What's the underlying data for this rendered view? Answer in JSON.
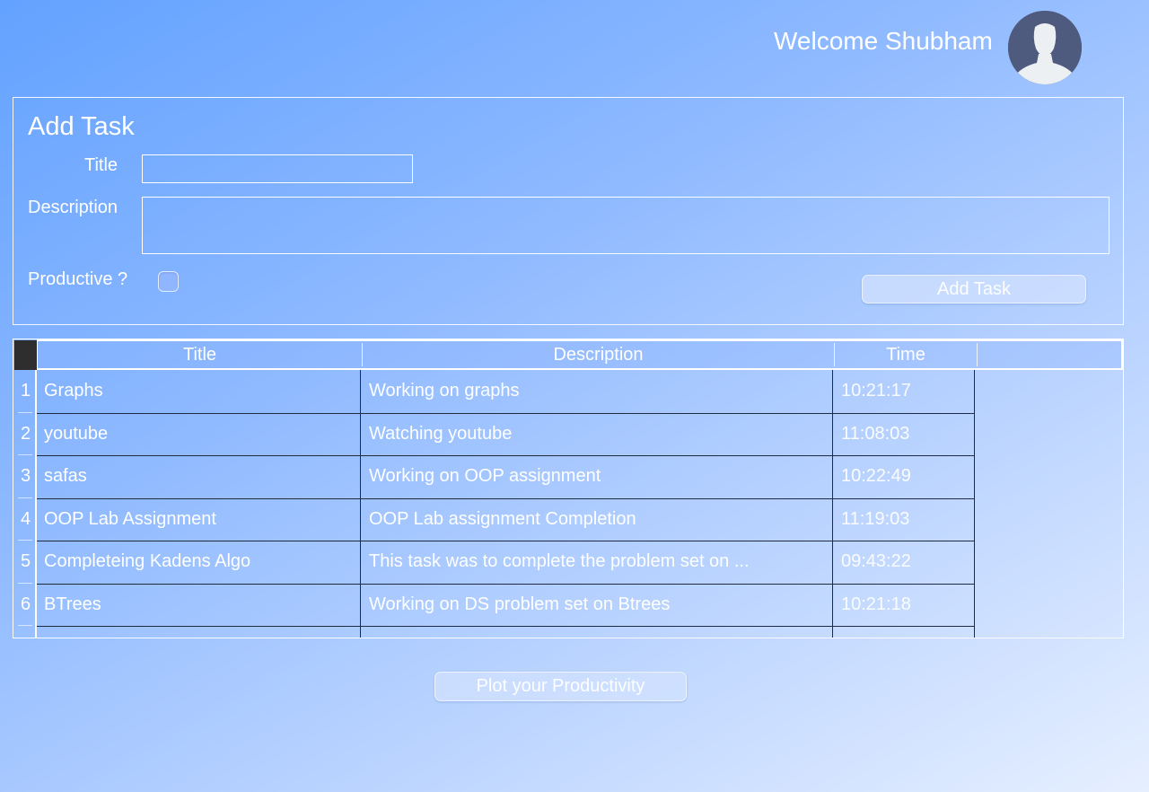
{
  "header": {
    "welcome_text": "Welcome Shubham",
    "avatar_icon": "user-silhouette-icon"
  },
  "add_task": {
    "heading": "Add Task",
    "title_label": "Title",
    "title_value": "",
    "description_label": "Description",
    "description_value": "",
    "productive_label": "Productive ?",
    "productive_checked": false,
    "submit_label": "Add Task"
  },
  "tasks_table": {
    "columns": [
      "Title",
      "Description",
      "Time"
    ],
    "rows": [
      {
        "num": "1",
        "title": "Graphs",
        "description": "Working on graphs",
        "time": "10:21:17"
      },
      {
        "num": "2",
        "title": "youtube",
        "description": "Watching youtube",
        "time": "11:08:03"
      },
      {
        "num": "3",
        "title": "safas",
        "description": "Working on OOP assignment",
        "time": "10:22:49"
      },
      {
        "num": "4",
        "title": "OOP Lab Assignment",
        "description": "OOP Lab assignment Completion",
        "time": "11:19:03"
      },
      {
        "num": "5",
        "title": "Completeing Kadens Algo",
        "description": "This task was to complete the problem set on ...",
        "time": "09:43:22"
      },
      {
        "num": "6",
        "title": "BTrees",
        "description": "Working on DS problem set on Btrees",
        "time": "10:21:18"
      }
    ]
  },
  "plot_button_label": "Plot your Productivity",
  "colors": {
    "gradient_start": "#63a2ff",
    "gradient_end": "#e6efff",
    "avatar_bg": "#4e5a7e",
    "grid_line": "#1f2a44"
  }
}
